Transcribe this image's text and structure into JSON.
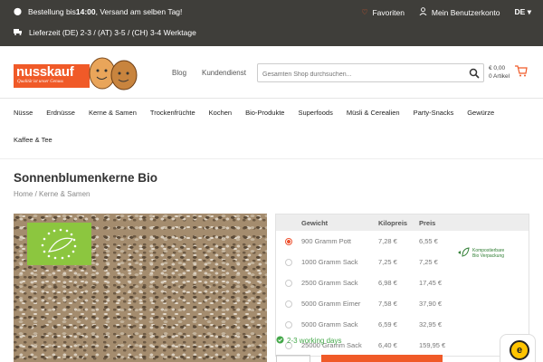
{
  "topbar": {
    "line1_prefix": "Bestellung bis ",
    "line1_time": "14:00",
    "line1_suffix": ", Versand am selben Tag!",
    "line2": "Lieferzeit (DE) 2-3 / (AT) 3-5 / (CH) 3-4 Werktage",
    "favorites": "Favoriten",
    "account": "Mein Benutzerkonto",
    "language": "DE"
  },
  "brand": {
    "name": "nusskauf",
    "tagline": "Qualität ist unser Genuss",
    "accent": "#f05a28"
  },
  "header": {
    "links": [
      "Blog",
      "Kundendienst"
    ],
    "search_placeholder": "Gesamten Shop durchsuchen...",
    "cart_total": "€ 0,00",
    "cart_items": "0 Artikel"
  },
  "categories": {
    "row1": [
      "Nüsse",
      "Erdnüsse",
      "Kerne & Samen",
      "Trockenfrüchte",
      "Kochen",
      "Bio-Produkte",
      "Superfoods",
      "Müsli & Cerealien",
      "Party-Snacks",
      "Gewürze"
    ],
    "row2": [
      "Kaffee & Tee"
    ]
  },
  "product": {
    "title": "Sonnenblumenkerne Bio",
    "breadcrumb_home": "Home",
    "breadcrumb_cat": " / Kerne & Samen",
    "availability": "2-3 working days"
  },
  "price_table": {
    "headers": [
      "Gewicht",
      "Kilopreis",
      "Preis"
    ],
    "rows": [
      {
        "weight": "900 Gramm Pott",
        "kilo": "7,28 €",
        "price": "6,55 €",
        "selected": true
      },
      {
        "weight": "1000 Gramm Sack",
        "kilo": "7,25 €",
        "price": "7,25 €",
        "selected": false
      },
      {
        "weight": "2500 Gramm Sack",
        "kilo": "6,98 €",
        "price": "17,45 €",
        "selected": false
      },
      {
        "weight": "5000 Gramm Eimer",
        "kilo": "7,58 €",
        "price": "37,90 €",
        "selected": false
      },
      {
        "weight": "5000 Gramm Sack",
        "kilo": "6,59 €",
        "price": "32,95 €",
        "selected": false
      },
      {
        "weight": "25000 Gramm Sack",
        "kilo": "6,40 €",
        "price": "159,95 €",
        "selected": false
      }
    ],
    "kompost_line1": "Kompostierbare",
    "kompost_line2": "Bio Verpackung"
  },
  "badge": {
    "trusted_letter": "e"
  }
}
